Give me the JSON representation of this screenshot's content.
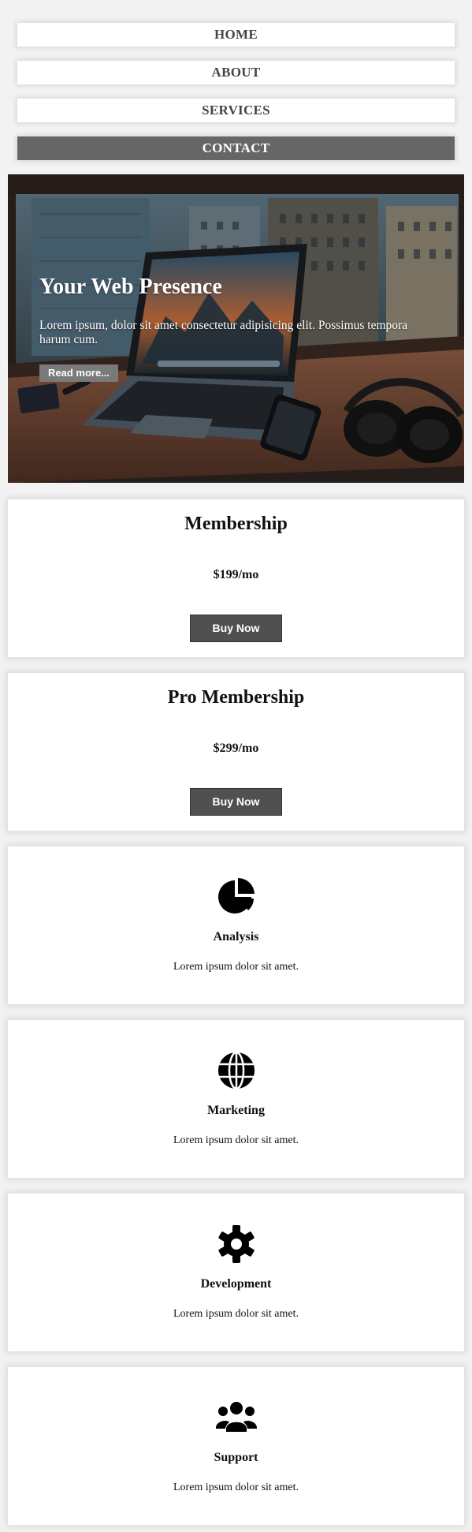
{
  "nav": {
    "items": [
      {
        "label": "HOME"
      },
      {
        "label": "ABOUT"
      },
      {
        "label": "SERVICES"
      },
      {
        "label": "CONTACT"
      }
    ]
  },
  "hero": {
    "title": "Your Web Presence",
    "text": "Lorem ipsum, dolor sit amet consectetur adipisicing elit. Possimus tempora harum cum.",
    "button_label": "Read more..."
  },
  "plans": [
    {
      "title": "Membership",
      "price": "$199/mo",
      "button_label": "Buy Now"
    },
    {
      "title": "Pro Membership",
      "price": "$299/mo",
      "button_label": "Buy Now"
    }
  ],
  "features": [
    {
      "icon": "pie-chart-icon",
      "title": "Analysis",
      "text": "Lorem ipsum dolor sit amet."
    },
    {
      "icon": "globe-icon",
      "title": "Marketing",
      "text": "Lorem ipsum dolor sit amet."
    },
    {
      "icon": "gear-icon",
      "title": "Development",
      "text": "Lorem ipsum dolor sit amet."
    },
    {
      "icon": "users-icon",
      "title": "Support",
      "text": "Lorem ipsum dolor sit amet."
    }
  ],
  "colors": {
    "background": "#f3f2f2",
    "nav_active": "#666666",
    "button": "#505050"
  }
}
